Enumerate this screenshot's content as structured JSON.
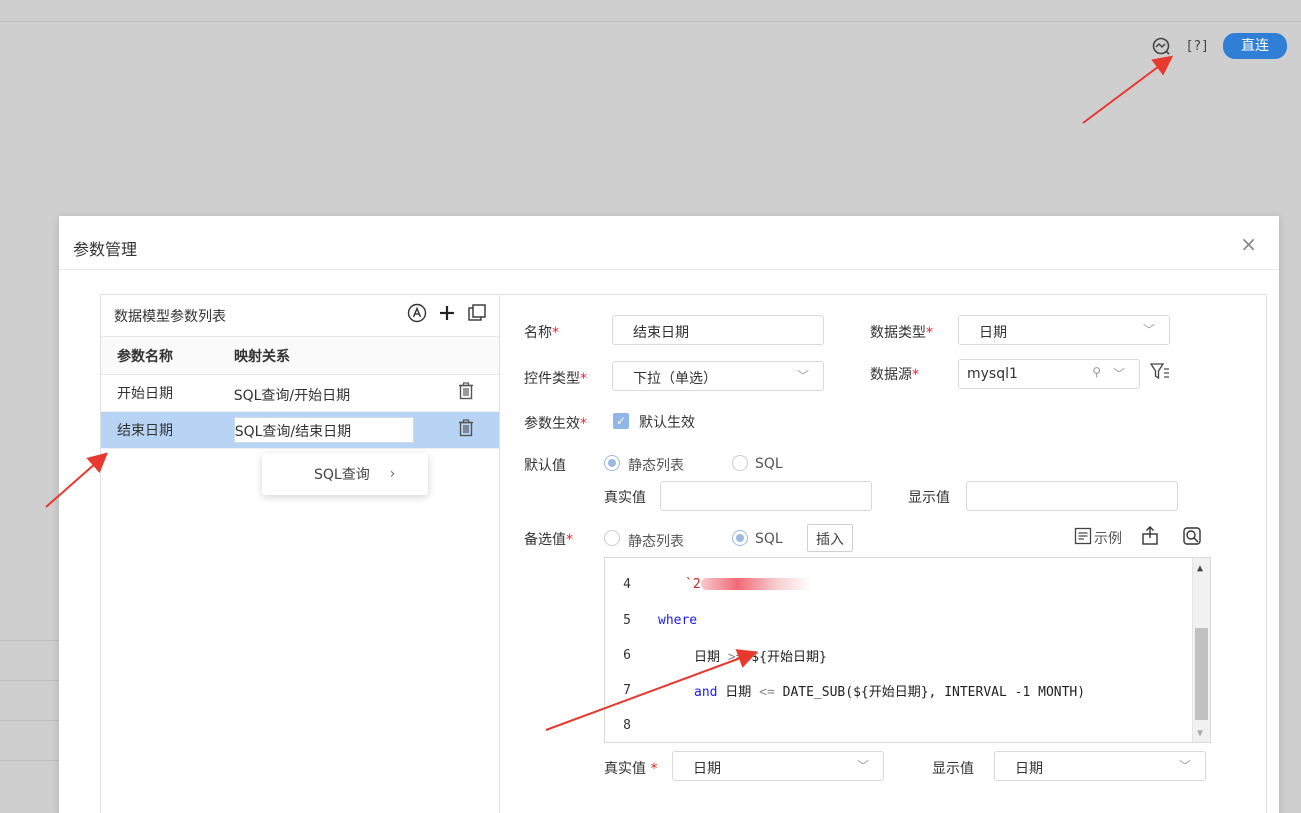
{
  "topbar": {
    "connect_label": "直连",
    "help_label": "[?]"
  },
  "dialog": {
    "title": "参数管理",
    "close": "×"
  },
  "param_list": {
    "header": "数据模型参数列表",
    "columns": [
      "参数名称",
      "映射关系"
    ],
    "rows": [
      {
        "name": "开始日期",
        "mapping": "SQL查询/开始日期"
      },
      {
        "name": "结束日期",
        "mapping": "SQL查询/结束日期"
      }
    ],
    "context_menu": {
      "label": "SQL查询",
      "arrow": "›"
    }
  },
  "form": {
    "name_label": "名称",
    "name_value": "结束日期",
    "data_type_label": "数据类型",
    "data_type_value": "日期",
    "control_type_label": "控件类型",
    "control_type_value": "下拉（单选）",
    "datasource_label": "数据源",
    "datasource_value": "mysql1",
    "effect_label": "参数生效",
    "effect_checkbox_label": "默认生效",
    "default_label": "默认值",
    "default_option_static": "静态列表",
    "default_option_sql": "SQL",
    "real_value_label": "真实值",
    "display_value_label": "显示值",
    "alt_label": "备选值",
    "alt_option_static": "静态列表",
    "alt_option_sql": "SQL",
    "insert_label": "插入",
    "example_label": "示例",
    "required_mark": "*",
    "bottom_real_label": "真实值",
    "bottom_real_value": "日期",
    "bottom_display_label": "显示值",
    "bottom_display_value": "日期"
  },
  "code": {
    "lines": [
      {
        "n": "4",
        "text": "`2"
      },
      {
        "n": "5",
        "text": "where"
      },
      {
        "n": "6",
        "pre": "日期 ",
        "op": ">=",
        "post": " ${开始日期}"
      },
      {
        "n": "7",
        "kw": "and",
        "pre": " 日期 ",
        "op": "<=",
        "post": " DATE_SUB(${开始日期}, INTERVAL -1 MONTH)"
      },
      {
        "n": "8",
        "text": ""
      }
    ]
  },
  "colors": {
    "accent": "#2f7fd6",
    "selected_row": "#b8d4f5",
    "required": "#e23",
    "arrow": "#e8392f"
  }
}
